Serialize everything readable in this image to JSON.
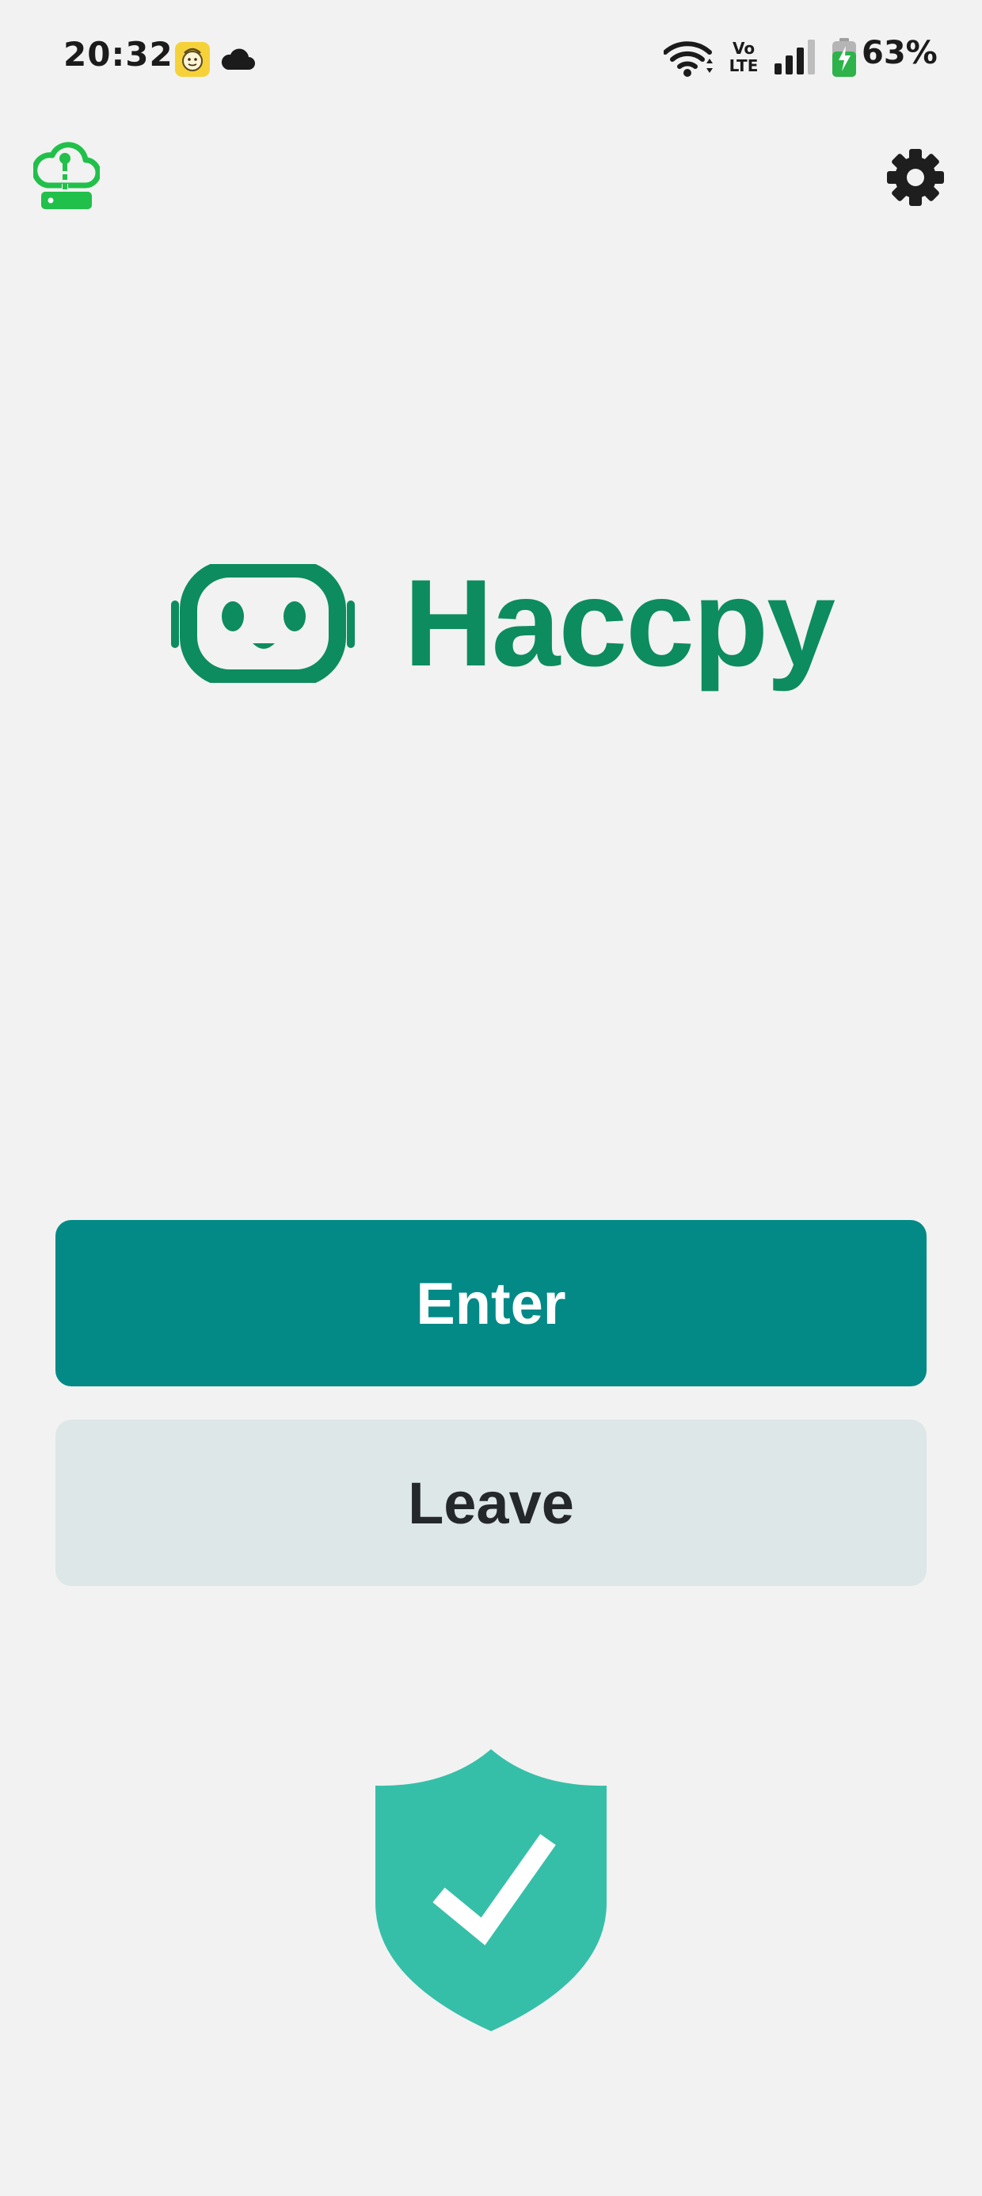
{
  "status_bar": {
    "time": "20:32",
    "notification_icons": [
      "app-notification-icon",
      "cloud-icon"
    ],
    "network": "VoLTE",
    "network_line1": "Vo",
    "network_line2": "LTE",
    "battery_percent": "63%",
    "battery_charging": true
  },
  "toolbar": {
    "left_icon": "cloud-vpn-server-icon",
    "right_icon": "gear-icon"
  },
  "brand": {
    "logo_icon": "robot-face-icon",
    "name": "Haccpy"
  },
  "actions": {
    "enter_label": "Enter",
    "leave_label": "Leave"
  },
  "status": {
    "icon": "shield-check-icon"
  },
  "colors": {
    "background": "#f2f2f2",
    "brand_green": "#0d8c5f",
    "enter_button": "#038a87",
    "leave_button": "#dde7e7",
    "shield": "#35bfa8",
    "vpn_icon": "#21c04a"
  }
}
